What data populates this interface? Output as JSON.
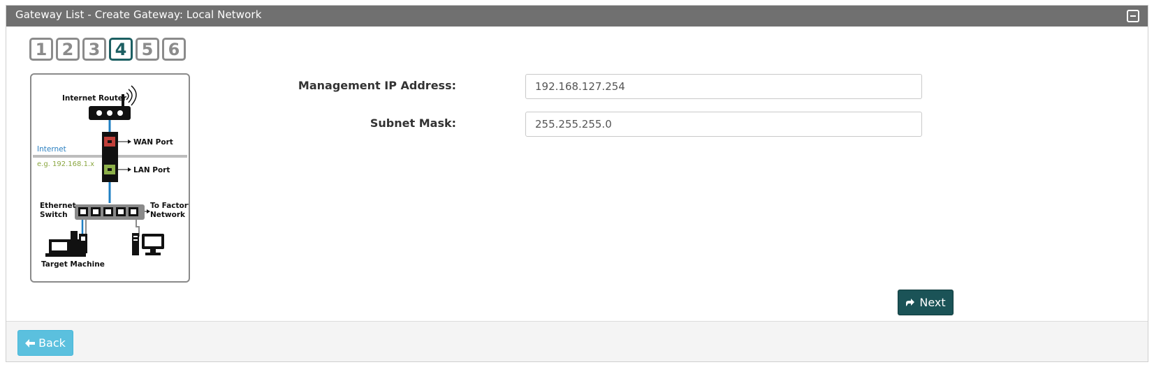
{
  "panel": {
    "title": "Gateway List - Create Gateway: Local Network",
    "collapse_icon": "minus-square-icon"
  },
  "steps": [
    "1",
    "2",
    "3",
    "4",
    "5",
    "6"
  ],
  "active_step": "4",
  "diagram": {
    "internet_router": "Internet Router",
    "wan_port": "WAN Port",
    "lan_port": "LAN Port",
    "internet": "Internet",
    "example_ip": "e.g. 192.168.1.x",
    "ethernet": "Ethernet",
    "switch": "Switch",
    "to_factory": "To Factory",
    "network": "Network",
    "target_machine": "Target Machine",
    "colors": {
      "wan": "#c0403a",
      "lan": "#8db04a",
      "cable": "#1f7fc3",
      "internet_text": "#2a7fc0",
      "ip_text": "#8aa640"
    }
  },
  "form": {
    "mgmt_ip_label": "Management IP Address:",
    "mgmt_ip_value": "192.168.127.254",
    "subnet_label": "Subnet Mask:",
    "subnet_value": "255.255.255.0"
  },
  "buttons": {
    "next_label": "Next",
    "next_icon": "share-icon",
    "back_label": "Back",
    "back_icon": "arrow-left-icon"
  },
  "colors": {
    "header_bg": "#707070",
    "next_bg": "#1b5357",
    "back_bg": "#5bc0de",
    "active_step": "#1c5f62"
  }
}
